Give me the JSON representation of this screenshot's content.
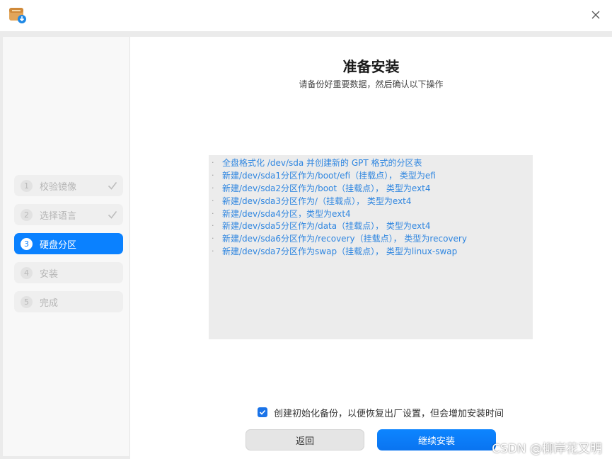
{
  "window": {
    "icons": {
      "app": "installer-app-icon",
      "close": "close-icon"
    }
  },
  "steps": [
    {
      "num": "1",
      "label": "校验镜像",
      "state": "done"
    },
    {
      "num": "2",
      "label": "选择语言",
      "state": "done"
    },
    {
      "num": "3",
      "label": "硬盘分区",
      "state": "active"
    },
    {
      "num": "4",
      "label": "安装",
      "state": "pending"
    },
    {
      "num": "5",
      "label": "完成",
      "state": "pending"
    }
  ],
  "main": {
    "title": "准备安装",
    "subtitle": "请备份好重要数据，然后确认以下操作"
  },
  "operations": [
    "全盘格式化 /dev/sda 并创建新的 GPT 格式的分区表",
    "新建/dev/sda1分区作为/boot/efi（挂载点）， 类型为efi",
    "新建/dev/sda2分区作为/boot（挂载点）， 类型为ext4",
    "新建/dev/sda3分区作为/（挂载点）， 类型为ext4",
    "新建/dev/sda4分区，类型为ext4",
    "新建/dev/sda5分区作为/data（挂载点）， 类型为ext4",
    "新建/dev/sda6分区作为/recovery（挂载点）， 类型为recovery",
    "新建/dev/sda7分区作为swap（挂载点）， 类型为linux-swap"
  ],
  "backup": {
    "label": "创建初始化备份，以便恢复出厂设置，但会增加安装时间",
    "checked": true
  },
  "buttons": {
    "back": "返回",
    "next": "继续安装"
  },
  "watermark": "CSDN @柳岸花又明",
  "colors": {
    "accent": "#0a81ff",
    "op_text": "#2f86e0"
  }
}
